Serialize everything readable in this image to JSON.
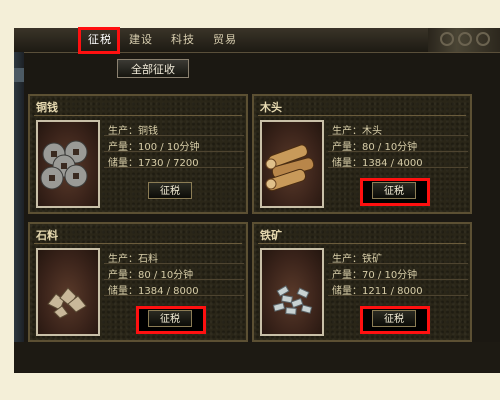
{
  "tabs": [
    {
      "label": "征税",
      "active": true
    },
    {
      "label": "建设",
      "active": false
    },
    {
      "label": "科技",
      "active": false
    },
    {
      "label": "贸易",
      "active": false
    }
  ],
  "collect_all_label": "全部征收",
  "resources": [
    {
      "name": "铜钱",
      "production": "生产：铜钱",
      "output": "产量：100 / 10分钟",
      "storage": "储量：1730 / 7200",
      "button": "征税",
      "icon": "coins-icon"
    },
    {
      "name": "木头",
      "production": "生产：木头",
      "output": "产量：80 / 10分钟",
      "storage": "储量：1384 / 4000",
      "button": "征税",
      "icon": "wood-icon"
    },
    {
      "name": "石料",
      "production": "生产：石料",
      "output": "产量：80 / 10分钟",
      "storage": "储量：1384 / 8000",
      "button": "征税",
      "icon": "stone-icon"
    },
    {
      "name": "铁矿",
      "production": "生产：铁矿",
      "output": "产量：70 / 10分钟",
      "storage": "储量：1211 / 8000",
      "button": "征税",
      "icon": "iron-ore-icon"
    }
  ],
  "colors": {
    "highlight": "#ff1010",
    "panel_border": "#5c5033",
    "text": "#d7cda8"
  }
}
